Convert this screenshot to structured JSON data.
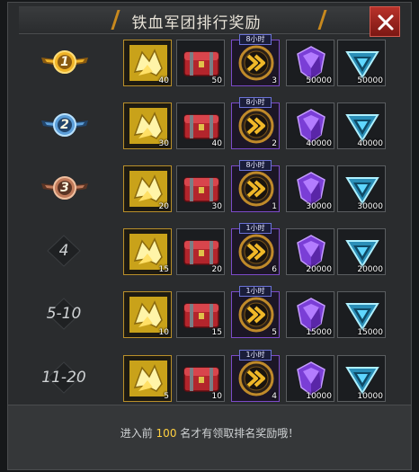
{
  "title": "铁血军团排行奖励",
  "footer": {
    "prefix": "进入前",
    "count": "100",
    "suffix": "名才有领取排名奖励哦！"
  },
  "colors": {
    "accent": "#c8891e",
    "close": "#b8322a",
    "highlight": "#ffd040"
  },
  "rows": [
    {
      "rank_label": "1",
      "rank_style": "gold-medal",
      "items": [
        {
          "icon": "gold-fragments-icon",
          "qty": "40"
        },
        {
          "icon": "red-chest-icon",
          "qty": "50"
        },
        {
          "icon": "speedup-icon",
          "qty": "3",
          "tag": "8小时"
        },
        {
          "icon": "purple-gem-icon",
          "qty": "50000"
        },
        {
          "icon": "blue-gem-icon",
          "qty": "50000"
        }
      ]
    },
    {
      "rank_label": "2",
      "rank_style": "silver-medal",
      "items": [
        {
          "icon": "gold-fragments-icon",
          "qty": "30"
        },
        {
          "icon": "red-chest-icon",
          "qty": "40"
        },
        {
          "icon": "speedup-icon",
          "qty": "2",
          "tag": "8小时"
        },
        {
          "icon": "purple-gem-icon",
          "qty": "40000"
        },
        {
          "icon": "blue-gem-icon",
          "qty": "40000"
        }
      ]
    },
    {
      "rank_label": "3",
      "rank_style": "bronze-medal",
      "items": [
        {
          "icon": "gold-fragments-icon",
          "qty": "20"
        },
        {
          "icon": "red-chest-icon",
          "qty": "30"
        },
        {
          "icon": "speedup-icon",
          "qty": "1",
          "tag": "8小时"
        },
        {
          "icon": "purple-gem-icon",
          "qty": "30000"
        },
        {
          "icon": "blue-gem-icon",
          "qty": "30000"
        }
      ]
    },
    {
      "rank_label": "4",
      "rank_style": "plain",
      "items": [
        {
          "icon": "gold-fragments-icon",
          "qty": "15"
        },
        {
          "icon": "red-chest-icon",
          "qty": "20"
        },
        {
          "icon": "speedup-icon",
          "qty": "6",
          "tag": "1小时"
        },
        {
          "icon": "purple-gem-icon",
          "qty": "20000"
        },
        {
          "icon": "blue-gem-icon",
          "qty": "20000"
        }
      ]
    },
    {
      "rank_label": "5-10",
      "rank_style": "plain",
      "items": [
        {
          "icon": "gold-fragments-icon",
          "qty": "10"
        },
        {
          "icon": "red-chest-icon",
          "qty": "15"
        },
        {
          "icon": "speedup-icon",
          "qty": "5",
          "tag": "1小时"
        },
        {
          "icon": "purple-gem-icon",
          "qty": "15000"
        },
        {
          "icon": "blue-gem-icon",
          "qty": "15000"
        }
      ]
    },
    {
      "rank_label": "11-20",
      "rank_style": "plain",
      "items": [
        {
          "icon": "gold-fragments-icon",
          "qty": "5"
        },
        {
          "icon": "red-chest-icon",
          "qty": "10"
        },
        {
          "icon": "speedup-icon",
          "qty": "4",
          "tag": "1小时"
        },
        {
          "icon": "purple-gem-icon",
          "qty": "10000"
        },
        {
          "icon": "blue-gem-icon",
          "qty": "10000"
        }
      ]
    }
  ]
}
